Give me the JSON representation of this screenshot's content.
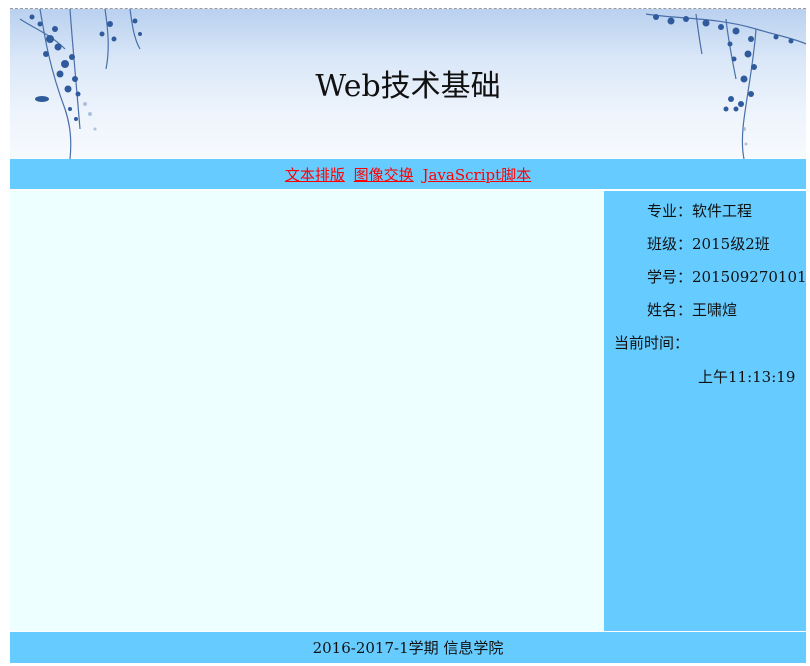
{
  "header": {
    "title": "Web技术基础"
  },
  "nav": {
    "links": [
      {
        "label": "文本排版"
      },
      {
        "label": "图像交换"
      },
      {
        "label": "JavaScript脚本"
      }
    ],
    "link_color": "#ff0000",
    "background": "#66ccff"
  },
  "sidebar": {
    "major_label": "专业：",
    "major_value": "软件工程",
    "class_label": "班级：",
    "class_value": "2015级2班",
    "id_label": "学号：",
    "id_value": "201509270101",
    "name_label": "姓名：",
    "name_value": "王啸煊",
    "time_label": "当前时间：",
    "time_value": "上午11:13:19"
  },
  "footer": {
    "text": "2016-2017-1学期 信息学院"
  },
  "colors": {
    "accent": "#66ccff",
    "content_bg": "#eeffff"
  },
  "icons": {
    "banner_decoration": "blue-floral-branch-illustration"
  }
}
